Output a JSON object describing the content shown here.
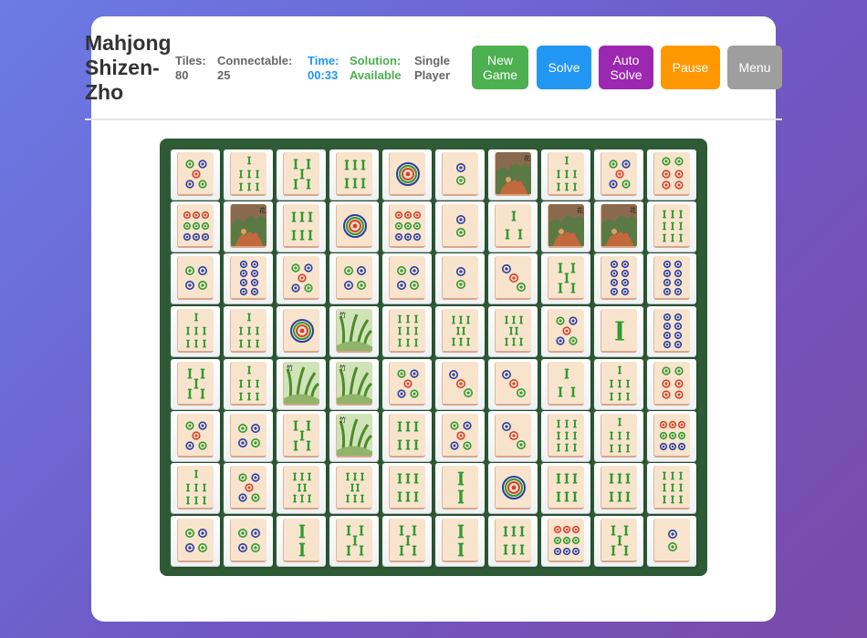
{
  "header": {
    "title_lines": [
      "Mahjong",
      "Shizen-",
      "Zho"
    ],
    "tiles": {
      "label": "Tiles:",
      "value": "80"
    },
    "connectable": {
      "label": "Connectable:",
      "value": "25"
    },
    "time": {
      "label": "Time:",
      "value": "00:33"
    },
    "solution": {
      "label": "Solution:",
      "value": "Available"
    },
    "mode": {
      "line1": "Single",
      "line2": "Player"
    }
  },
  "buttons": {
    "new_game": {
      "line1": "New",
      "line2": "Game",
      "color": "#4CAF50"
    },
    "solve": {
      "label": "Solve",
      "color": "#2196F3"
    },
    "auto_solve": {
      "line1": "Auto",
      "line2": "Solve",
      "color": "#9C27B0"
    },
    "pause": {
      "label": "Pause",
      "color": "#FF9800"
    },
    "menu": {
      "label": "Menu",
      "color": "#9E9E9E"
    }
  },
  "board": {
    "background": "#2e5a36",
    "rows": [
      [
        "circle-5",
        "bamboo-7",
        "bamboo-5",
        "bamboo-6",
        "circle-1",
        "circle-2",
        "flower",
        "bamboo-7",
        "circle-5",
        "circle-6"
      ],
      [
        "circle-9",
        "flower",
        "bamboo-6",
        "circle-1",
        "circle-9",
        "circle-2",
        "bamboo-3",
        "flower",
        "flower",
        "bamboo-9"
      ],
      [
        "circle-4",
        "circle-8",
        "circle-5",
        "circle-4",
        "circle-4",
        "circle-2",
        "circle-3",
        "bamboo-5",
        "circle-8",
        "circle-8"
      ],
      [
        "bamboo-7",
        "bamboo-7",
        "circle-1",
        "plant",
        "bamboo-9",
        "bamboo-8",
        "bamboo-8",
        "circle-5",
        "bamboo-1",
        "circle-8"
      ],
      [
        "bamboo-5",
        "bamboo-7",
        "plant",
        "plant",
        "circle-5",
        "circle-3",
        "circle-3",
        "bamboo-3",
        "bamboo-7",
        "circle-6"
      ],
      [
        "circle-5",
        "circle-4",
        "bamboo-5",
        "plant",
        "bamboo-6",
        "circle-5",
        "circle-3",
        "bamboo-9",
        "bamboo-7",
        "circle-9"
      ],
      [
        "bamboo-7",
        "circle-5",
        "bamboo-8",
        "bamboo-8",
        "bamboo-6",
        "bamboo-2",
        "circle-1",
        "bamboo-6",
        "bamboo-6",
        "bamboo-9"
      ],
      [
        "circle-4",
        "circle-4",
        "bamboo-2",
        "bamboo-5",
        "bamboo-5",
        "bamboo-2",
        "bamboo-6",
        "circle-9",
        "bamboo-5",
        "circle-2"
      ]
    ]
  }
}
